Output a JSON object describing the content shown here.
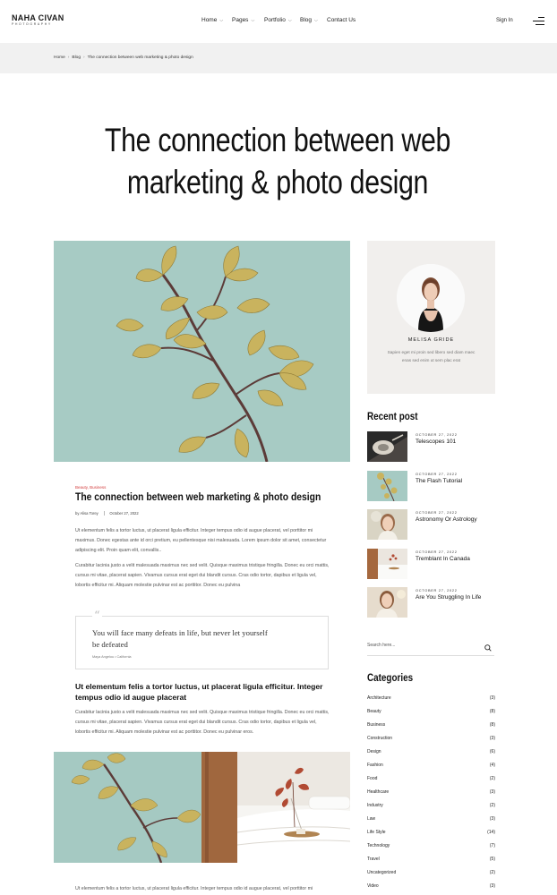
{
  "brand": {
    "name": "NAHA CIVAN",
    "tagline": "PHOTOGRAPHY"
  },
  "nav": [
    {
      "label": "Home",
      "dropdown": true
    },
    {
      "label": "Pages",
      "dropdown": true
    },
    {
      "label": "Portfolio",
      "dropdown": true
    },
    {
      "label": "Blog",
      "dropdown": true
    },
    {
      "label": "Contact Us",
      "dropdown": false
    }
  ],
  "header": {
    "signin": "Sign In",
    "menu_icon": "hamburger-menu-icon"
  },
  "breadcrumb": [
    "Home",
    "Blog",
    "The connection between web marketing & photo design"
  ],
  "page": {
    "title_line1": "The connection between web",
    "title_line2": "marketing & photo design"
  },
  "post": {
    "categories": "Beauty, Business",
    "title": "The connection between web marketing & photo design",
    "author": "by Alisa Torey",
    "date": "October 27, 2022",
    "paragraph1": "Ut elementum felis a tortor luctus, ut placerat ligula efficitur. Integer tempus odio id augue placerat, vel porttitor mi maximus. Donec egestas ante id orci pretium, eu pellentesque nisi malesuada. Lorem ipsum dolor sit amet, consectetur adipiscing elit. Proin quam elit, convallis..",
    "paragraph2": "Curabitur lacinia justo a velit malesuada maximus nec sed velit. Quisque maximus tristique fringilla. Donec eu orci mattis, cursus mi vitae, placerat sapien. Vivamus cursus erat eget dui blandit cursus. Cras odio tortor, dapibus et ligula vel, lobortis efficitur mi. Aliquam molestie pulvinar est ac porttitor. Donec eu pulvina",
    "quote": "You will face many defeats in life, but never let yourself be defeated",
    "quote_cite": "Maya Angelou • California",
    "subheading": "Ut elementum felis a tortor luctus, ut placerat ligula efficitur. Integer tempus odio id augue placerat",
    "paragraph3": "Curabitur lacinia justo a velit malesuada maximus nec sed velit. Quisque maximus tristique fringilla. Donec eu orci mattis, cursus mi vitae, placerat sapien. Vivamus cursus erat eget dui blandit cursus. Cras odio tortor, dapibus et ligula vel, lobortis efficitur mi. Aliquam molestie pulvinar est ac porttitor. Donec eu pulvinar eros.",
    "paragraph4": "Ut elementum felis a tortor luctus, ut placerat ligula efficitur. Integer tempus odio id augue placerat, vel porttitor mi"
  },
  "author_box": {
    "name": "MELISA GRIDE",
    "bio": "Sapien eget mi proin sed libero sed diam maec enas sed enim ut sem plac erat"
  },
  "recent": {
    "heading": "Recent post",
    "items": [
      {
        "date": "OCTOBER 27, 2022",
        "title": "Telescopes 101"
      },
      {
        "date": "OCTOBER 27, 2022",
        "title": "The Flash Tutorial"
      },
      {
        "date": "OCTOBER 27, 2022",
        "title": "Astronomy Or Astrology"
      },
      {
        "date": "OCTOBER 27, 2022",
        "title": "Tremblant In Canada"
      },
      {
        "date": "OCTOBER 27, 2022",
        "title": "Are You Struggling In Life"
      }
    ]
  },
  "search": {
    "placeholder": "Search here..."
  },
  "categories": {
    "heading": "Categories",
    "items": [
      {
        "name": "Architecture",
        "count": "(3)"
      },
      {
        "name": "Beauty",
        "count": "(8)"
      },
      {
        "name": "Business",
        "count": "(8)"
      },
      {
        "name": "Construction",
        "count": "(3)"
      },
      {
        "name": "Design",
        "count": "(6)"
      },
      {
        "name": "Fashion",
        "count": "(4)"
      },
      {
        "name": "Food",
        "count": "(2)"
      },
      {
        "name": "Healthcare",
        "count": "(3)"
      },
      {
        "name": "Industry",
        "count": "(2)"
      },
      {
        "name": "Law",
        "count": "(3)"
      },
      {
        "name": "Life Style",
        "count": "(14)"
      },
      {
        "name": "Technology",
        "count": "(7)"
      },
      {
        "name": "Travel",
        "count": "(5)"
      },
      {
        "name": "Uncategorized",
        "count": "(2)"
      },
      {
        "name": "Video",
        "count": "(3)"
      }
    ]
  }
}
